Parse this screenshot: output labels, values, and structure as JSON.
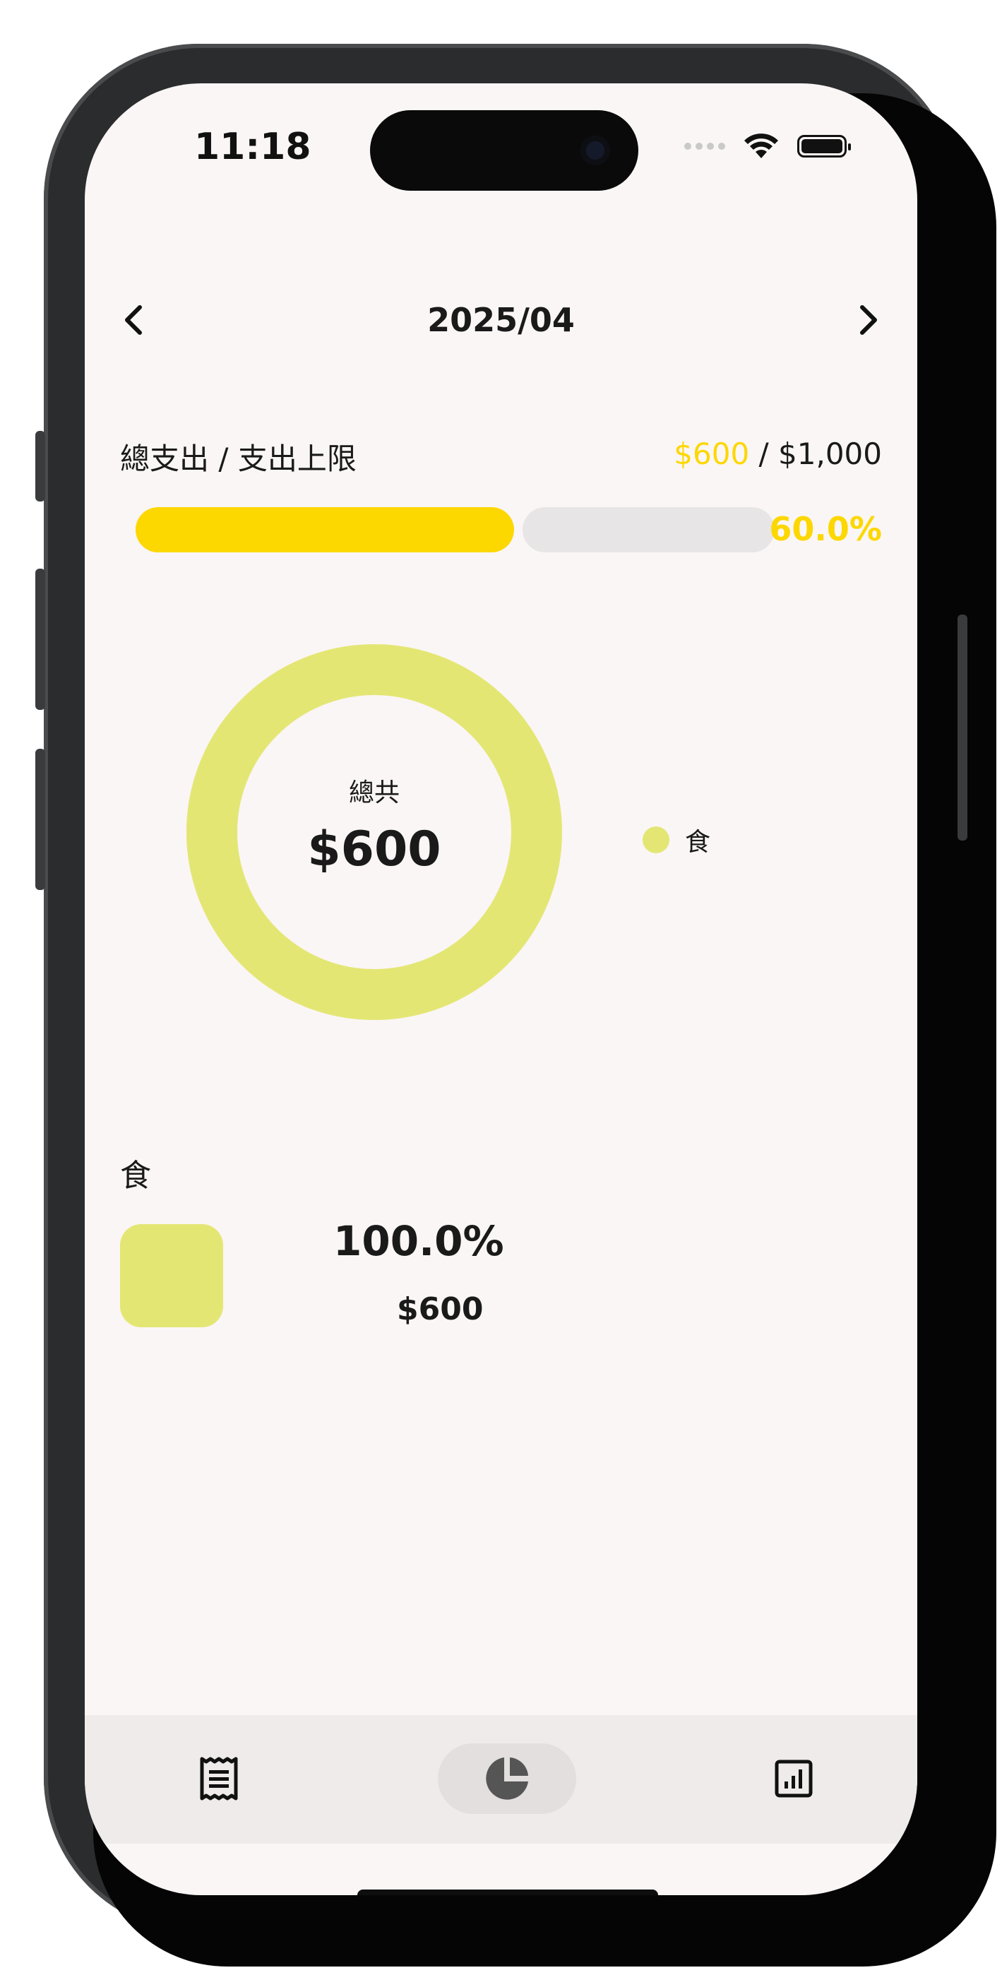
{
  "status_bar": {
    "time": "11:18"
  },
  "nav": {
    "title": "2025/04",
    "prev_icon": "chevron-left-icon",
    "next_icon": "chevron-right-icon"
  },
  "budget": {
    "label": "總支出 / 支出上限",
    "spent": "$600",
    "separator": " / ",
    "limit": "$1,000",
    "percent_text": "60.0%",
    "progress_fraction": 0.6
  },
  "donut": {
    "center_label": "總共",
    "center_value": "$600"
  },
  "chart_data": {
    "type": "pie",
    "categories": [
      "食"
    ],
    "values": [
      600
    ]
  },
  "legend": [
    {
      "label": "食"
    }
  ],
  "categories": [
    {
      "name": "食",
      "percent": "100.0%",
      "amount": "$600"
    }
  ],
  "tabbar": {
    "tabs": [
      {
        "icon": "receipt-icon",
        "active": false
      },
      {
        "icon": "pie-chart-icon",
        "active": true
      },
      {
        "icon": "bar-chart-icon",
        "active": false
      }
    ]
  },
  "colors": {
    "accent": "#fdd700",
    "category_food": "#e4e674",
    "track": "#e8e5e6",
    "background": "#faf6f5"
  }
}
